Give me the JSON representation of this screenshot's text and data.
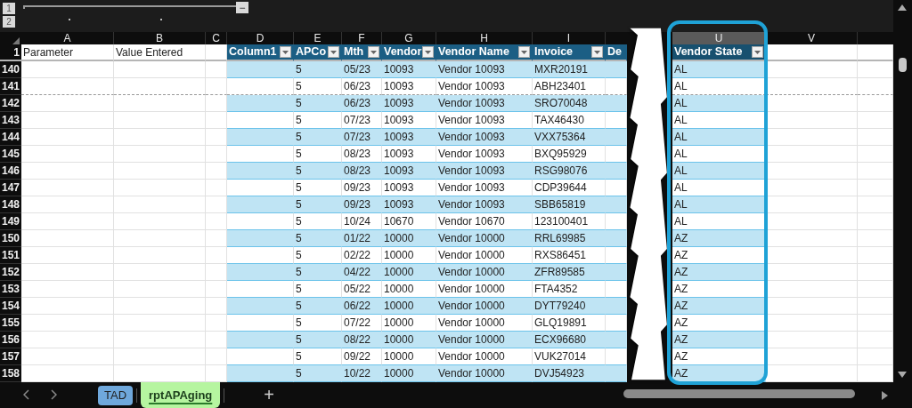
{
  "outline": {
    "levels": [
      "1",
      "2"
    ],
    "collapse_button": "−"
  },
  "column_letters": [
    {
      "letter": "A",
      "selected": false
    },
    {
      "letter": "B",
      "selected": false
    },
    {
      "letter": "C",
      "selected": false
    },
    {
      "letter": "D",
      "selected": false
    },
    {
      "letter": "E",
      "selected": false
    },
    {
      "letter": "F",
      "selected": false
    },
    {
      "letter": "G",
      "selected": false
    },
    {
      "letter": "H",
      "selected": false
    },
    {
      "letter": "I",
      "selected": false
    },
    {
      "letter": "U",
      "selected": true
    },
    {
      "letter": "V",
      "selected": false
    }
  ],
  "header_row": {
    "number": "1",
    "parameter_labels": [
      "Parameter",
      "Value Entered"
    ]
  },
  "table": {
    "columns": [
      {
        "label": "Column1",
        "filter_button": true
      },
      {
        "label": "APCo",
        "filter_button": true
      },
      {
        "label": "Mth",
        "filter_button": true
      },
      {
        "label": "Vendor",
        "filter_button": true
      },
      {
        "label": "Vendor Name",
        "filter_button": true
      },
      {
        "label": "Invoice",
        "filter_button": true
      },
      {
        "label": "De",
        "filter_button": false
      },
      {
        "label": "Vendor State",
        "filter_button": true
      }
    ],
    "rows": [
      {
        "number": "140",
        "page_break": false,
        "cells": [
          "",
          "5",
          "05/23",
          "10093",
          "Vendor 10093",
          "MXR20191",
          "",
          "AL"
        ]
      },
      {
        "number": "141",
        "page_break": true,
        "cells": [
          "",
          "5",
          "06/23",
          "10093",
          "Vendor 10093",
          "ABH23401",
          "",
          "AL"
        ]
      },
      {
        "number": "142",
        "page_break": false,
        "cells": [
          "",
          "5",
          "06/23",
          "10093",
          "Vendor 10093",
          "SRO70048",
          "",
          "AL"
        ]
      },
      {
        "number": "143",
        "page_break": false,
        "cells": [
          "",
          "5",
          "07/23",
          "10093",
          "Vendor 10093",
          "TAX46430",
          "",
          "AL"
        ]
      },
      {
        "number": "144",
        "page_break": false,
        "cells": [
          "",
          "5",
          "07/23",
          "10093",
          "Vendor 10093",
          "VXX75364",
          "",
          "AL"
        ]
      },
      {
        "number": "145",
        "page_break": false,
        "cells": [
          "",
          "5",
          "08/23",
          "10093",
          "Vendor 10093",
          "BXQ95929",
          "",
          "AL"
        ]
      },
      {
        "number": "146",
        "page_break": false,
        "cells": [
          "",
          "5",
          "08/23",
          "10093",
          "Vendor 10093",
          "RSG98076",
          "",
          "AL"
        ]
      },
      {
        "number": "147",
        "page_break": false,
        "cells": [
          "",
          "5",
          "09/23",
          "10093",
          "Vendor 10093",
          "CDP39644",
          "",
          "AL"
        ]
      },
      {
        "number": "148",
        "page_break": false,
        "cells": [
          "",
          "5",
          "09/23",
          "10093",
          "Vendor 10093",
          "SBB65819",
          "",
          "AL"
        ]
      },
      {
        "number": "149",
        "page_break": false,
        "cells": [
          "",
          "5",
          "10/24",
          "10670",
          "Vendor 10670",
          "123100401",
          "",
          "AL"
        ]
      },
      {
        "number": "150",
        "page_break": false,
        "cells": [
          "",
          "5",
          "01/22",
          "10000",
          "Vendor 10000",
          "RRL69985",
          "",
          "AZ"
        ]
      },
      {
        "number": "151",
        "page_break": false,
        "cells": [
          "",
          "5",
          "02/22",
          "10000",
          "Vendor 10000",
          "RXS86451",
          "",
          "AZ"
        ]
      },
      {
        "number": "152",
        "page_break": false,
        "cells": [
          "",
          "5",
          "04/22",
          "10000",
          "Vendor 10000",
          "ZFR89585",
          "",
          "AZ"
        ]
      },
      {
        "number": "153",
        "page_break": false,
        "cells": [
          "",
          "5",
          "05/22",
          "10000",
          "Vendor 10000",
          "FTA4352",
          "",
          "AZ"
        ]
      },
      {
        "number": "154",
        "page_break": false,
        "cells": [
          "",
          "5",
          "06/22",
          "10000",
          "Vendor 10000",
          "DYT79240",
          "",
          "AZ"
        ]
      },
      {
        "number": "155",
        "page_break": false,
        "cells": [
          "",
          "5",
          "07/22",
          "10000",
          "Vendor 10000",
          "GLQ19891",
          "",
          "AZ"
        ]
      },
      {
        "number": "156",
        "page_break": false,
        "cells": [
          "",
          "5",
          "08/22",
          "10000",
          "Vendor 10000",
          "ECX96680",
          "",
          "AZ"
        ]
      },
      {
        "number": "157",
        "page_break": false,
        "cells": [
          "",
          "5",
          "09/22",
          "10000",
          "Vendor 10000",
          "VUK27014",
          "",
          "AZ"
        ]
      },
      {
        "number": "158",
        "page_break": false,
        "cells": [
          "",
          "5",
          "10/22",
          "10000",
          "Vendor 10000",
          "DVJ54923",
          "",
          "AZ"
        ]
      }
    ]
  },
  "sheet_tabs": [
    {
      "label": "TAD",
      "selected": false,
      "color": "#6fa8dc"
    },
    {
      "label": "rptAPAging",
      "selected": true,
      "color": "#b6f5a0"
    }
  ],
  "new_sheet_button": "+"
}
